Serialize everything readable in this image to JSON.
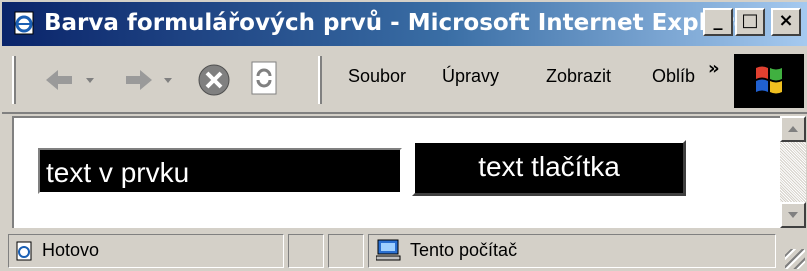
{
  "window": {
    "title": "Barva formulářových prvů - Microsoft Internet Explorer",
    "controls": {
      "minimize": "_",
      "maximize": "□",
      "close": "×"
    }
  },
  "toolbar": {
    "icons": [
      "back-icon",
      "forward-icon",
      "stop-icon",
      "refresh-icon"
    ],
    "menu": [
      "Soubor",
      "Úpravy",
      "Zobrazit",
      "Oblíb"
    ],
    "overflow": "»"
  },
  "page": {
    "text_input_value": "text v prvku",
    "button_label": "text tlačítka"
  },
  "statusbar": {
    "status": "Hotovo",
    "zone": "Tento počítač"
  },
  "colors": {
    "titlebar_start": "#0a246a",
    "titlebar_end": "#a6caf0",
    "chrome": "#d4d0c8",
    "form_bg": "#000000",
    "form_text": "#ffffff"
  }
}
